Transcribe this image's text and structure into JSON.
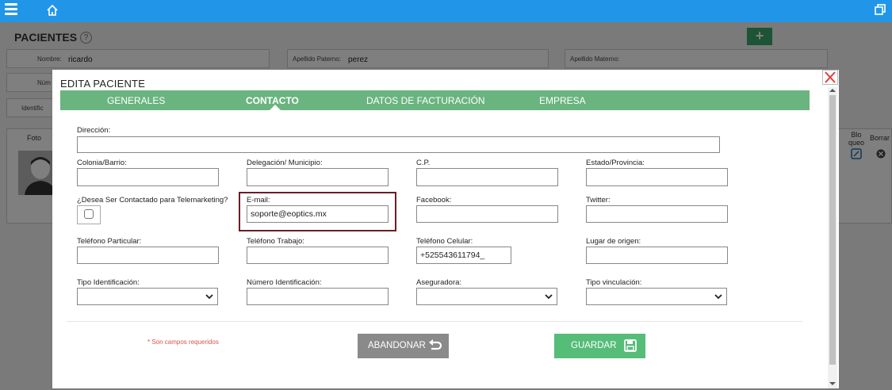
{
  "background": {
    "page_title": "PACIENTES",
    "help_symbol": "?",
    "add_symbol": "+",
    "fields": [
      {
        "label": "Nombre:",
        "value": "ricardo"
      },
      {
        "label": "Apellido Paterno:",
        "value": "perez"
      },
      {
        "label": "Apellido Materno:",
        "value": ""
      },
      {
        "label": "Núm",
        "value": ""
      },
      {
        "label": "Identific",
        "value": ""
      }
    ],
    "table_headers": {
      "foto": "Foto",
      "bloqueo": "Blo\nqueo",
      "borrar": "Borrar"
    }
  },
  "modal": {
    "title": "EDITA PACIENTE",
    "tabs": [
      {
        "label": "GENERALES"
      },
      {
        "label": "CONTACTO"
      },
      {
        "label": "DATOS DE FACTURACIÓN"
      },
      {
        "label": "EMPRESA"
      }
    ],
    "active_tab": "CONTACTO",
    "fields": {
      "direccion": {
        "label": "Dirección:",
        "value": ""
      },
      "colonia": {
        "label": "Colonia/Barrio:",
        "value": ""
      },
      "delegacion": {
        "label": "Delegación/ Municipio:",
        "value": ""
      },
      "cp": {
        "label": "C.P.",
        "value": ""
      },
      "estado": {
        "label": "Estado/Provincia:",
        "value": ""
      },
      "telemarketing": {
        "label": "¿Desea Ser Contactado para Telemarketing?",
        "checked": false
      },
      "email": {
        "label": "E-mail:",
        "value": "soporte@eoptics.mx"
      },
      "facebook": {
        "label": "Facebook:",
        "value": ""
      },
      "twitter": {
        "label": "Twitter:",
        "value": ""
      },
      "tel_particular": {
        "label": "Teléfono Particular:",
        "value": ""
      },
      "tel_trabajo": {
        "label": "Teléfono Trabajo:",
        "value": ""
      },
      "tel_celular": {
        "label": "Teléfono Celular:",
        "value": "+525543611794_"
      },
      "lugar_origen": {
        "label": "Lugar de origen:",
        "value": ""
      },
      "tipo_identificacion": {
        "label": "Tipo Identificación:",
        "value": ""
      },
      "numero_identificacion": {
        "label": "Número Identificación:",
        "value": ""
      },
      "aseguradora": {
        "label": "Aseguradora:",
        "value": ""
      },
      "tipo_vinculacion": {
        "label": "Tipo vinculación:",
        "value": ""
      }
    },
    "required_note": "* Son campos requeridos",
    "abandon_label": "ABANDONAR",
    "save_label": "GUARDAR"
  },
  "colors": {
    "topbar": "#2196e8",
    "tabs": "#6ab47f",
    "save": "#55bd78",
    "abandon": "#8a8a8a",
    "highlight": "#6b1e24",
    "required": "#d9534f"
  }
}
